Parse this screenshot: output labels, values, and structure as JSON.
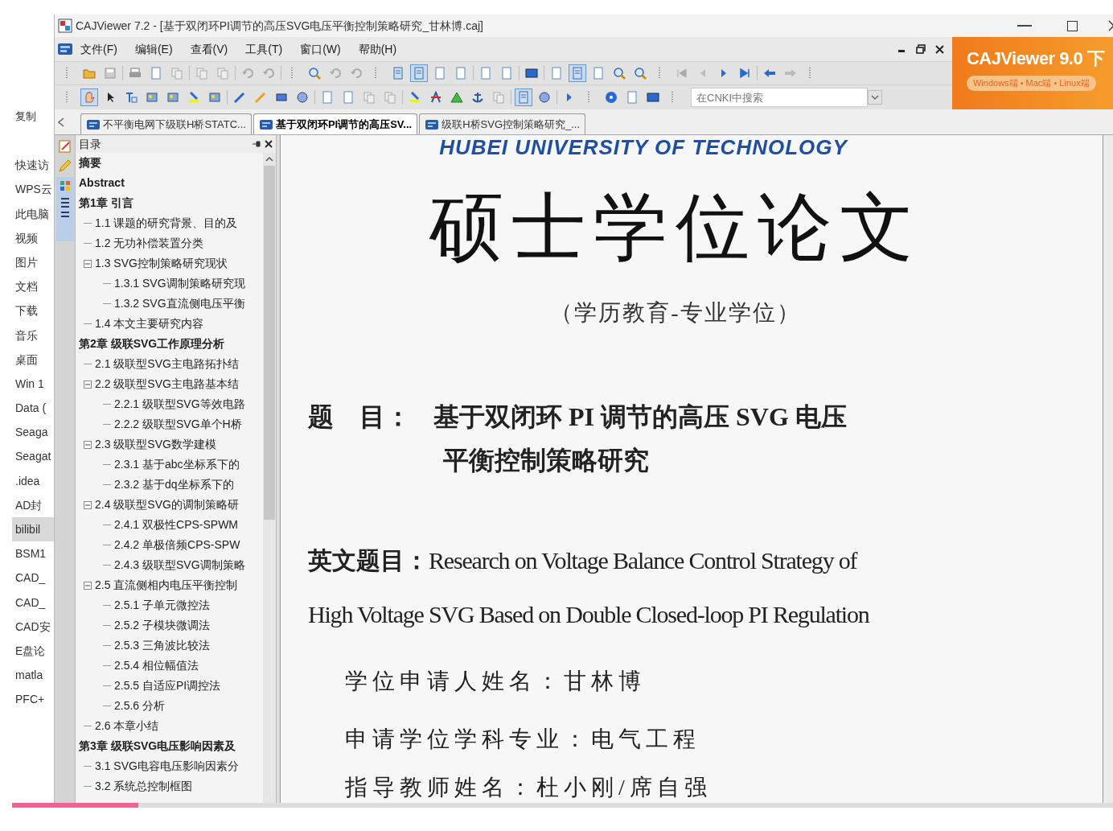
{
  "explorer": {
    "items": [
      {
        "label": "复制",
        "selected": false
      },
      {
        "label": "快速访",
        "selected": false
      },
      {
        "label": "WPS云",
        "selected": false
      },
      {
        "label": "此电脑",
        "selected": false
      },
      {
        "label": "视频",
        "selected": false
      },
      {
        "label": "图片",
        "selected": false
      },
      {
        "label": "文档",
        "selected": false
      },
      {
        "label": "下载",
        "selected": false
      },
      {
        "label": "音乐",
        "selected": false
      },
      {
        "label": "桌面",
        "selected": false
      },
      {
        "label": "Win 1",
        "selected": false
      },
      {
        "label": "Data (",
        "selected": false
      },
      {
        "label": "Seaga",
        "selected": false
      },
      {
        "label": "Seagat",
        "selected": false
      },
      {
        "label": ".idea",
        "selected": false
      },
      {
        "label": "AD封",
        "selected": false
      },
      {
        "label": "bilibil",
        "selected": true
      },
      {
        "label": "BSM1",
        "selected": false
      },
      {
        "label": "CAD_",
        "selected": false
      },
      {
        "label": "CAD_",
        "selected": false
      },
      {
        "label": "CAD安",
        "selected": false
      },
      {
        "label": "E盘论",
        "selected": false
      },
      {
        "label": "matla",
        "selected": false
      },
      {
        "label": "PFC+",
        "selected": false
      }
    ]
  },
  "window": {
    "title": "CAJViewer 7.2 - [基于双闭环PI调节的高压SVG电压平衡控制策略研究_甘林博.caj]"
  },
  "menu": [
    "文件(F)",
    "编辑(E)",
    "查看(V)",
    "工具(T)",
    "窗口(W)",
    "帮助(H)"
  ],
  "ad": {
    "title": "CAJViewer 9.0 下",
    "subtitle": "Windows端 • Mac端 • Linux端"
  },
  "search": {
    "placeholder": "在CNKI中搜索"
  },
  "tabs": [
    {
      "label": "不平衡电网下级联H桥STATC...",
      "selected": false
    },
    {
      "label": "基于双闭环PI调节的高压SV...",
      "selected": true
    },
    {
      "label": "级联H桥SVG控制策略研究_...",
      "selected": false
    }
  ],
  "toc": {
    "title": "目录",
    "items": [
      {
        "label": "摘要"
      },
      {
        "label": "Abstract"
      },
      {
        "label": "第1章 引言",
        "children": [
          {
            "label": "1.1 课题的研究背景、目的及"
          },
          {
            "label": "1.2 无功补偿装置分类"
          },
          {
            "label": "1.3 SVG控制策略研究现状",
            "expanded": true,
            "children": [
              {
                "label": "1.3.1 SVG调制策略研究现"
              },
              {
                "label": "1.3.2 SVG直流侧电压平衡"
              }
            ]
          },
          {
            "label": "1.4 本文主要研究内容"
          }
        ]
      },
      {
        "label": "第2章 级联SVG工作原理分析",
        "children": [
          {
            "label": "2.1 级联型SVG主电路拓扑结"
          },
          {
            "label": "2.2 级联型SVG主电路基本结",
            "expanded": true,
            "children": [
              {
                "label": "2.2.1 级联型SVG等效电路"
              },
              {
                "label": "2.2.2 级联型SVG单个H桥"
              }
            ]
          },
          {
            "label": "2.3 级联型SVG数学建模",
            "expanded": true,
            "children": [
              {
                "label": "2.3.1 基于abc坐标系下的"
              },
              {
                "label": "2.3.2 基于dq坐标系下的"
              }
            ]
          },
          {
            "label": "2.4 级联型SVG的调制策略研",
            "expanded": true,
            "children": [
              {
                "label": "2.4.1 双极性CPS-SPWM"
              },
              {
                "label": "2.4.2 单极倍频CPS-SPW"
              },
              {
                "label": "2.4.3 级联型SVG调制策略"
              }
            ]
          },
          {
            "label": "2.5 直流侧相内电压平衡控制",
            "expanded": true,
            "children": [
              {
                "label": "2.5.1 子单元微控法"
              },
              {
                "label": "2.5.2 子模块微调法"
              },
              {
                "label": "2.5.3 三角波比较法"
              },
              {
                "label": "2.5.4 相位幅值法"
              },
              {
                "label": "2.5.5 自适应PI调控法"
              },
              {
                "label": "2.5.6 分析"
              }
            ]
          },
          {
            "label": "2.6 本章小结"
          }
        ]
      },
      {
        "label": "第3章 级联SVG电压影响因素及",
        "children": [
          {
            "label": "3.1 SVG电容电压影响因素分"
          },
          {
            "label": "3.2 系统总控制框图"
          }
        ]
      }
    ]
  },
  "document": {
    "university": "HUBEI UNIVERSITY OF TECHNOLOGY",
    "heading": "硕士学位论文",
    "subheading": "（学历教育-专业学位）",
    "title_label": "题　目：",
    "title_lines": [
      "基于双闭环 PI 调节的高压 SVG 电压",
      "平衡控制策略研究"
    ],
    "english_label": "英文题目：",
    "english_lines": [
      "Research on Voltage Balance Control Strategy of",
      "High Voltage SVG Based on Double Closed-loop PI Regulation"
    ],
    "fields": [
      {
        "label": "学位申请人姓名：",
        "value": "甘林博"
      },
      {
        "label": "申请学位学科专业：",
        "value": "电气工程"
      },
      {
        "label": "指导教师姓名：",
        "value": "杜小刚/席自强"
      }
    ]
  },
  "video_progress": {
    "level": 0.115
  }
}
